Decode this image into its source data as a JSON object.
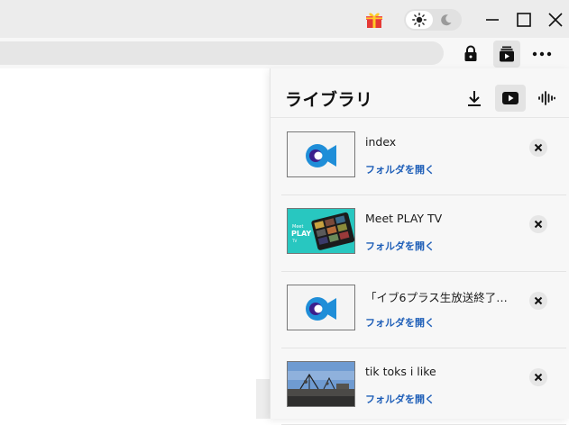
{
  "colors": {
    "accent": "#1f5fb8",
    "titlebar": "#ececec",
    "panel_bg": "#f7f7f7"
  },
  "titlebar": {
    "gift_icon": "gift-icon",
    "theme_light_icon": "sun-icon",
    "theme_dark_icon": "moon-icon",
    "minimize_icon": "minimize-icon",
    "maximize_icon": "maximize-icon",
    "close_icon": "close-icon"
  },
  "toolbar": {
    "lock_icon": "lock-icon",
    "library_icon": "library-icon",
    "more_icon": "more-icon"
  },
  "library": {
    "title": "ライブラリ",
    "tabs": [
      {
        "icon": "download-icon",
        "active": false
      },
      {
        "icon": "video-icon",
        "active": true
      },
      {
        "icon": "audio-icon",
        "active": false
      }
    ],
    "items": [
      {
        "title": "index",
        "open_label": "フォルダを開く",
        "thumbnail": "app-logo"
      },
      {
        "title": "Meet PLAY TV",
        "open_label": "フォルダを開く",
        "thumbnail": "playtv"
      },
      {
        "title": "「イブ6プラス生放送終了後…",
        "open_label": "フォルダを開く",
        "thumbnail": "app-logo"
      },
      {
        "title": "tik toks i like",
        "open_label": "フォルダを開く",
        "thumbnail": "landscape"
      }
    ]
  }
}
